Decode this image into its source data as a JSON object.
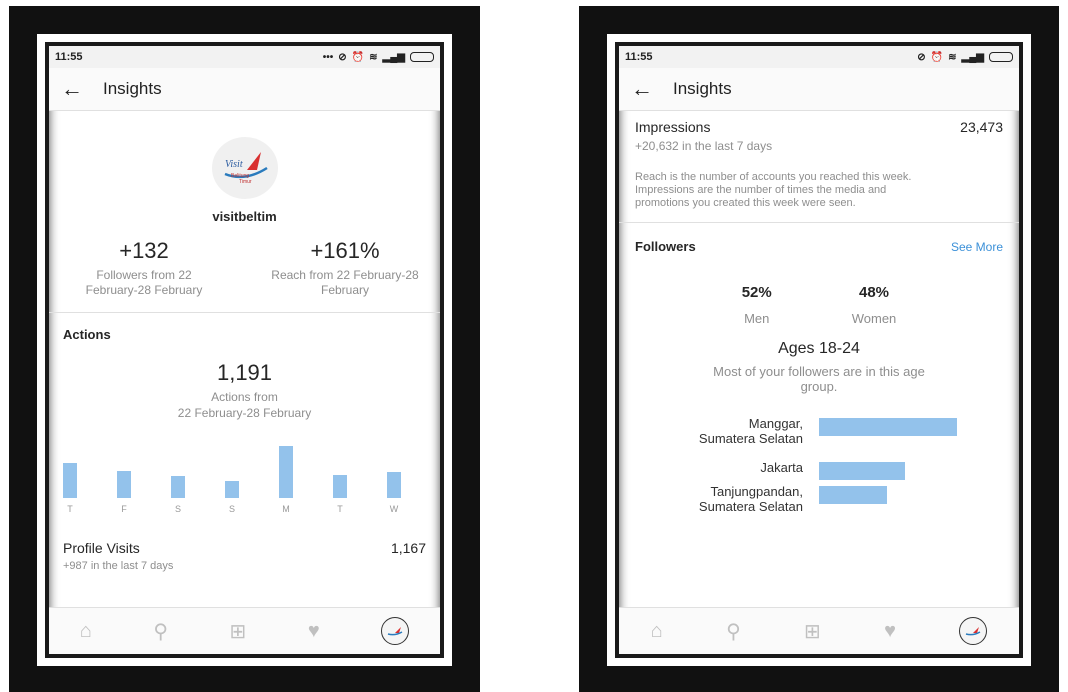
{
  "left": {
    "status_time": "11:55",
    "title": "Insights",
    "username": "visitbeltim",
    "logo_text": [
      "Visit",
      "Belitung",
      "Timur"
    ],
    "followers_stat": {
      "value": "+132",
      "caption": "Followers from 22 February-28 February"
    },
    "reach_stat": {
      "value": "+161%",
      "caption": "Reach from 22 February-28 February"
    },
    "actions": {
      "heading": "Actions",
      "value": "1,191",
      "caption_line1": "Actions from",
      "caption_line2": "22 February-28 February"
    },
    "profile_visits": {
      "label": "Profile Visits",
      "value": "1,167",
      "sub": "+987 in the last 7 days"
    }
  },
  "chart_data": {
    "type": "bar",
    "categories": [
      "T",
      "F",
      "S",
      "S",
      "M",
      "T",
      "W"
    ],
    "values": [
      155,
      123,
      100,
      74,
      233,
      103,
      115
    ],
    "title": "",
    "xlabel": "",
    "ylabel": ""
  },
  "right": {
    "status_time": "11:55",
    "title": "Insights",
    "impressions": {
      "label": "Impressions",
      "value": "23,473",
      "sub": "+20,632 in the last 7 days"
    },
    "note_line1": "Reach is the number of accounts you reached this week.",
    "note_line2": "Impressions are the number of times the media and",
    "note_line3": "promotions you created this week were seen.",
    "followers_heading": "Followers",
    "see_more": "See More",
    "men": {
      "percent": "52%",
      "label": "Men"
    },
    "women": {
      "percent": "48%",
      "label": "Women"
    },
    "age_group": "Ages 18-24",
    "age_caption_line1": "Most of your followers are in this age",
    "age_caption_line2": "group.",
    "locations": [
      {
        "line1": "Manggar,",
        "line2": "Sumatera Selatan",
        "share": 1.0
      },
      {
        "line1": "Jakarta",
        "line2": "",
        "share": 0.62
      },
      {
        "line1": "Tanjungpandan,",
        "line2": "Sumatera Selatan",
        "share": 0.49
      }
    ]
  },
  "nav_icons": [
    "home-icon",
    "search-icon",
    "add-icon",
    "heart-icon",
    "profile-avatar"
  ],
  "colors": {
    "bar": "#93c2eb",
    "link": "#3b90d8"
  }
}
